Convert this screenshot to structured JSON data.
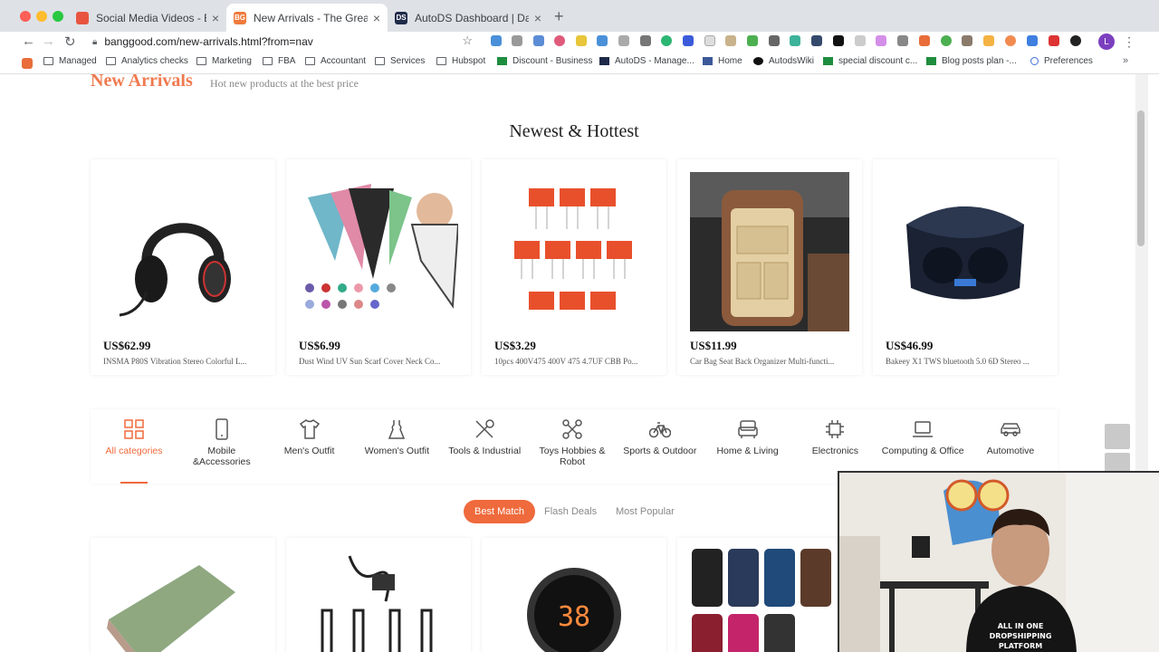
{
  "browser": {
    "tabs": [
      {
        "title": "Social Media Videos - Bangg",
        "favicon_color": "#e8543f"
      },
      {
        "title": "New Arrivals - The Greatest Deals",
        "favicon_color": "#ef7a3c"
      },
      {
        "title": "AutoDS Dashboard | Dashboard",
        "favicon_color": "#1e2a4a"
      }
    ],
    "url": "banggood.com/new-arrivals.html?from=nav",
    "profile_initial": "L",
    "bookmarks": [
      {
        "label": "Managed",
        "icon": "folder-icon"
      },
      {
        "label": "Analytics checks",
        "icon": "folder-icon"
      },
      {
        "label": "Marketing",
        "icon": "folder-icon"
      },
      {
        "label": "FBA",
        "icon": "folder-icon"
      },
      {
        "label": "Accountant",
        "icon": "folder-icon"
      },
      {
        "label": "Services",
        "icon": "folder-icon"
      },
      {
        "label": "Hubspot",
        "icon": "folder-icon"
      },
      {
        "label": "Discount - Business",
        "icon": "sheet-icon"
      },
      {
        "label": "AutoDS - Manage...",
        "icon": "autods-icon"
      },
      {
        "label": "Home",
        "icon": "facebook-icon"
      },
      {
        "label": "AutodsWiki",
        "icon": "wiki-icon"
      },
      {
        "label": "special discount c...",
        "icon": "sheet-icon"
      },
      {
        "label": "Blog posts plan -...",
        "icon": "sheet-icon"
      },
      {
        "label": "Preferences",
        "icon": "settings-icon"
      }
    ]
  },
  "page": {
    "section_title": "New Arrivals",
    "section_subtitle": "Hot new products at the best price",
    "hero_title": "Newest & Hottest",
    "products": [
      {
        "price": "US$62.99",
        "name": "INSMA P80S Vibration Stereo Colorful L..."
      },
      {
        "price": "US$6.99",
        "name": "Dust Wind UV Sun Scarf Cover Neck Co..."
      },
      {
        "price": "US$3.29",
        "name": "10pcs 400V475 400V 475 4.7UF CBB Po..."
      },
      {
        "price": "US$11.99",
        "name": "Car Bag Seat Back Organizer Multi-functi..."
      },
      {
        "price": "US$46.99",
        "name": "Bakeey X1 TWS bluetooth 5.0 6D Stereo ..."
      }
    ],
    "categories": [
      {
        "label": "All categories",
        "icon": "grid-icon",
        "active": true
      },
      {
        "label": "Mobile &Accessories",
        "icon": "phone-icon"
      },
      {
        "label": "Men's Outfit",
        "icon": "tshirt-icon"
      },
      {
        "label": "Women's Outfit",
        "icon": "dress-icon"
      },
      {
        "label": "Tools & Industrial",
        "icon": "tools-icon"
      },
      {
        "label": "Toys Hobbies & Robot",
        "icon": "drone-icon"
      },
      {
        "label": "Sports & Outdoor",
        "icon": "bicycle-icon"
      },
      {
        "label": "Home & Living",
        "icon": "sofa-icon"
      },
      {
        "label": "Electronics",
        "icon": "chip-icon"
      },
      {
        "label": "Computing & Office",
        "icon": "laptop-icon"
      },
      {
        "label": "Automotive",
        "icon": "car-icon"
      }
    ],
    "sort_tabs": [
      "Best Match",
      "Flash Deals",
      "Most Popular"
    ],
    "accent_color": "#ef6a3c"
  }
}
